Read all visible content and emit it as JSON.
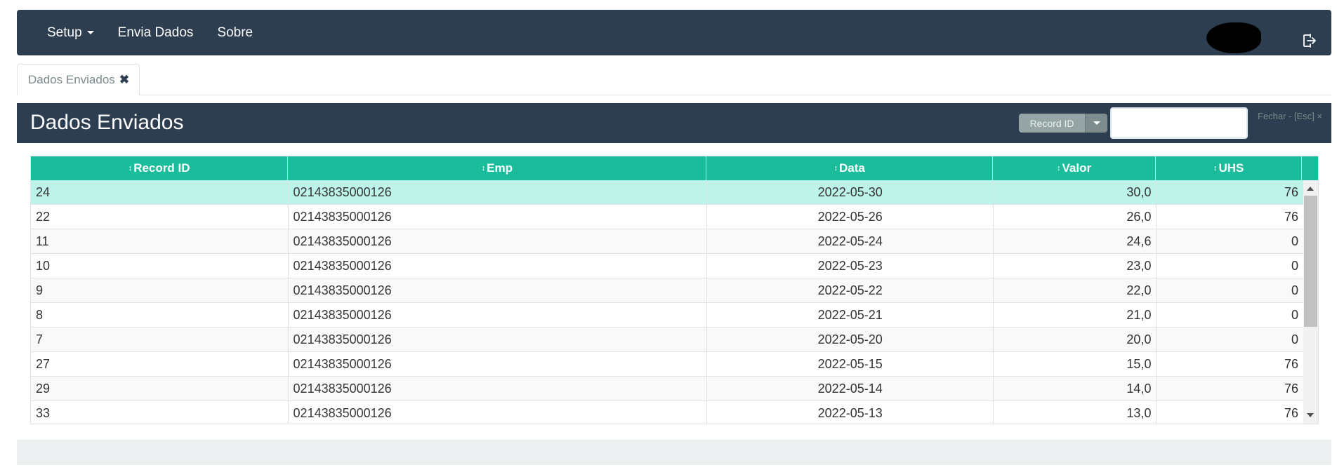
{
  "navbar": {
    "items": [
      {
        "label": "Setup",
        "dropdown": true
      },
      {
        "label": "Envia Dados",
        "dropdown": false
      },
      {
        "label": "Sobre",
        "dropdown": false
      }
    ],
    "logout_icon": "sign-out-icon"
  },
  "tabs": [
    {
      "label": "Dados Enviados",
      "close_icon": "close-x-icon"
    }
  ],
  "panel": {
    "title": "Dados Enviados",
    "search_field": "Record ID",
    "search_value": "",
    "close_label": "Fechar - [Esc] ×"
  },
  "table": {
    "sort_icon": "↕",
    "columns": [
      "Record ID",
      "Emp",
      "Data",
      "Valor",
      "UHS"
    ],
    "rows": [
      {
        "id": "24",
        "emp": "02143835000126",
        "data": "2022-05-30",
        "valor": "30,0",
        "uhs": "76"
      },
      {
        "id": "22",
        "emp": "02143835000126",
        "data": "2022-05-26",
        "valor": "26,0",
        "uhs": "76"
      },
      {
        "id": "11",
        "emp": "02143835000126",
        "data": "2022-05-24",
        "valor": "24,6",
        "uhs": "0"
      },
      {
        "id": "10",
        "emp": "02143835000126",
        "data": "2022-05-23",
        "valor": "23,0",
        "uhs": "0"
      },
      {
        "id": "9",
        "emp": "02143835000126",
        "data": "2022-05-22",
        "valor": "22,0",
        "uhs": "0"
      },
      {
        "id": "8",
        "emp": "02143835000126",
        "data": "2022-05-21",
        "valor": "21,0",
        "uhs": "0"
      },
      {
        "id": "7",
        "emp": "02143835000126",
        "data": "2022-05-20",
        "valor": "20,0",
        "uhs": "0"
      },
      {
        "id": "27",
        "emp": "02143835000126",
        "data": "2022-05-15",
        "valor": "15,0",
        "uhs": "76"
      },
      {
        "id": "29",
        "emp": "02143835000126",
        "data": "2022-05-14",
        "valor": "14,0",
        "uhs": "76"
      },
      {
        "id": "33",
        "emp": "02143835000126",
        "data": "2022-05-13",
        "valor": "13,0",
        "uhs": "76"
      }
    ],
    "selected_row": 0
  },
  "colors": {
    "navbar": "#2c3e50",
    "table_header": "#1abc9c",
    "selected_row": "#bdf3e8",
    "footer": "#ecf0f1"
  }
}
